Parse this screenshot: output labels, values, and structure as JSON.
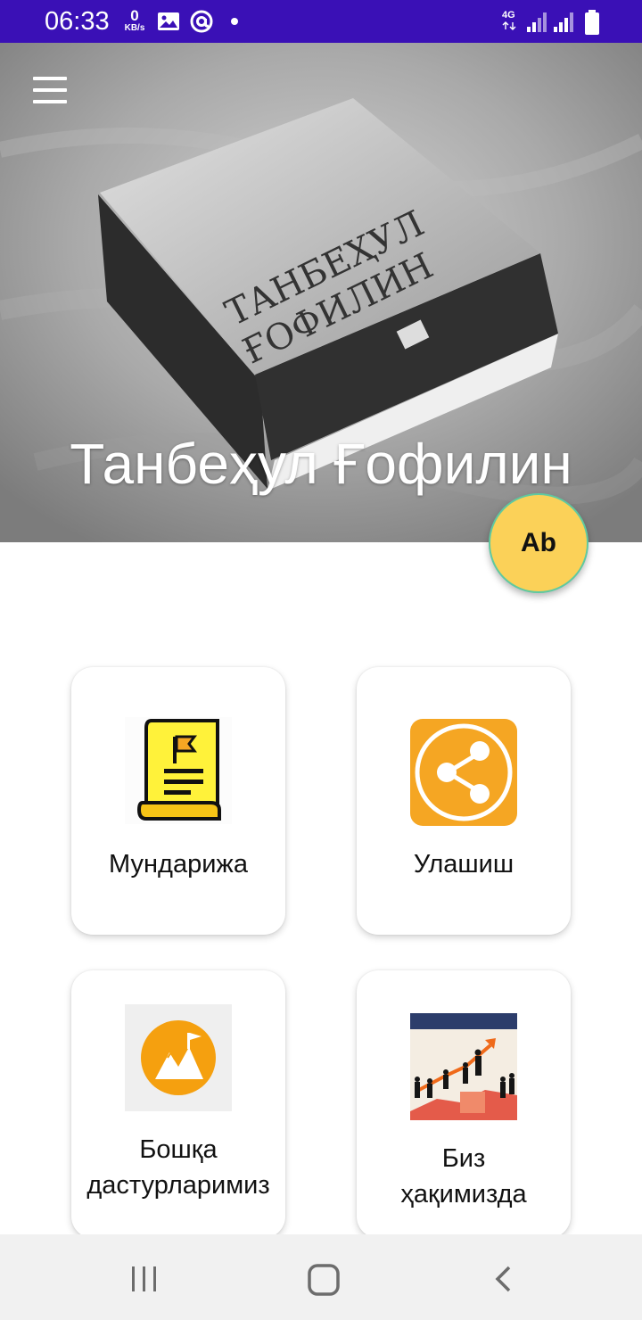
{
  "status_bar": {
    "time": "06:33",
    "speed_value": "0",
    "speed_unit": "KB/s",
    "network": "4G",
    "icons": [
      "image-icon",
      "at-icon",
      "dot-icon",
      "signal-icon",
      "signal-icon",
      "battery-icon"
    ]
  },
  "header": {
    "title": "Танбеҳул Ғофилин",
    "background": "book-photo",
    "menu_icon": "hamburger-menu-icon"
  },
  "fab": {
    "label": "Ab",
    "color": "#fbd158"
  },
  "cards": [
    {
      "label": "Мундарижа",
      "icon": "scroll-document-icon"
    },
    {
      "label": "Улашиш",
      "icon": "share-icon"
    },
    {
      "label_line1": "Бошқа",
      "label_line2": "дастурларимиз",
      "icon": "mountain-flag-icon"
    },
    {
      "label_line1": "Биз",
      "label_line2": "ҳақимизда",
      "icon": "business-growth-icon"
    }
  ],
  "nav_bar": {
    "icons": [
      "recents-icon",
      "home-icon",
      "back-icon"
    ]
  },
  "colors": {
    "status_bar": "#3a10b6",
    "accent_orange": "#f5a623",
    "card_bg": "#ffffff"
  }
}
